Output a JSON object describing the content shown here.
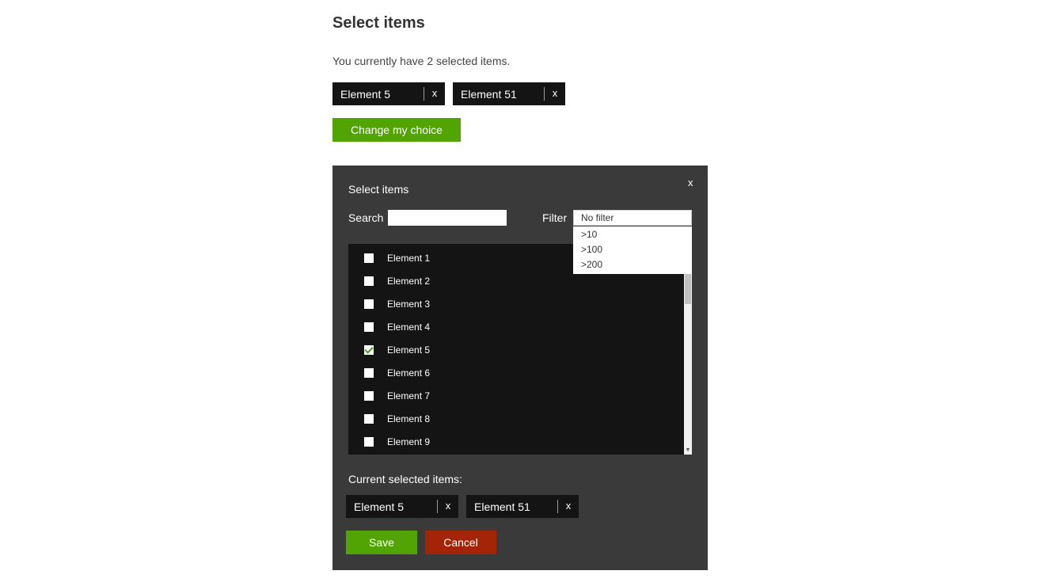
{
  "page": {
    "title": "Select items",
    "summary": "You currently have 2 selected items.",
    "selected_tags": [
      {
        "label": "Element 5",
        "remove": "x"
      },
      {
        "label": "Element 51",
        "remove": "x"
      }
    ],
    "change_button": "Change my choice"
  },
  "dialog": {
    "title": "Select items",
    "close": "x",
    "search": {
      "label": "Search",
      "value": "",
      "placeholder": ""
    },
    "filter": {
      "label": "Filter",
      "selected": "No filter",
      "options": [
        ">10",
        ">100",
        ">200"
      ]
    },
    "items": [
      {
        "label": "Element 1",
        "checked": false
      },
      {
        "label": "Element 2",
        "checked": false
      },
      {
        "label": "Element 3",
        "checked": false
      },
      {
        "label": "Element 4",
        "checked": false
      },
      {
        "label": "Element 5",
        "checked": true
      },
      {
        "label": "Element 6",
        "checked": false
      },
      {
        "label": "Element 7",
        "checked": false
      },
      {
        "label": "Element 8",
        "checked": false
      },
      {
        "label": "Element 9",
        "checked": false
      }
    ],
    "scroll_down_glyph": "▼",
    "current_label": "Current selected items:",
    "current_tags": [
      {
        "label": "Element 5",
        "remove": "x"
      },
      {
        "label": "Element 51",
        "remove": "x"
      }
    ],
    "save": "Save",
    "cancel": "Cancel"
  },
  "colors": {
    "accent_green": "#52a304",
    "cancel_red": "#a32407",
    "dialog_bg": "#3a3a3a",
    "list_bg": "#141414",
    "tag_bg": "#141414"
  }
}
